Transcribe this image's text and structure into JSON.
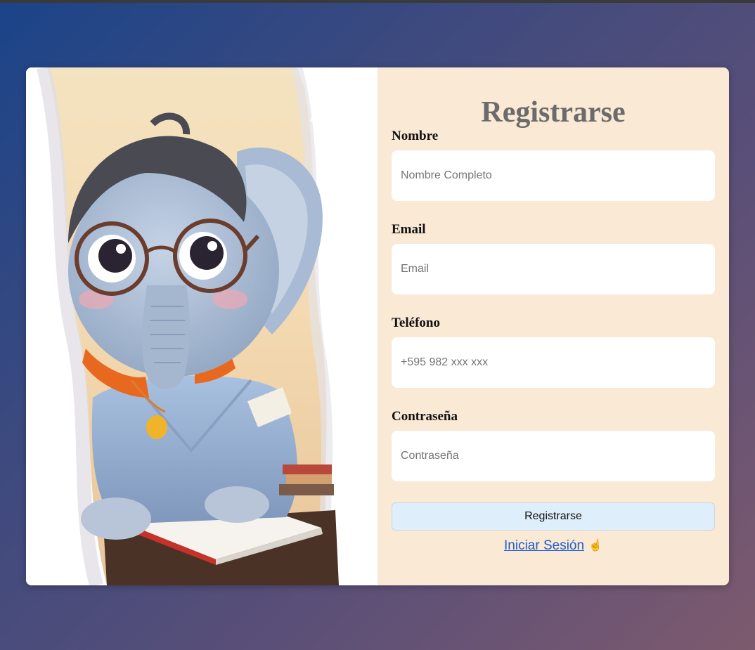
{
  "form": {
    "title": "Registrarse",
    "fields": [
      {
        "label": "Nombre",
        "placeholder": "Nombre Completo",
        "type": "text"
      },
      {
        "label": "Email",
        "placeholder": "Email",
        "type": "email"
      },
      {
        "label": "Teléfono",
        "placeholder": "+595 982 xxx xxx",
        "type": "tel"
      },
      {
        "label": "Contraseña",
        "placeholder": "Contraseña",
        "type": "password"
      }
    ],
    "submit_label": "Registrarse",
    "login_link": "Iniciar Sesión"
  },
  "illustration": {
    "subject": "elephant-with-glasses-reading-book"
  },
  "colors": {
    "form_panel": "#f9e9d5",
    "title": "#6b6b6b",
    "button_bg": "#deeefb",
    "link": "#1f5ccc"
  }
}
